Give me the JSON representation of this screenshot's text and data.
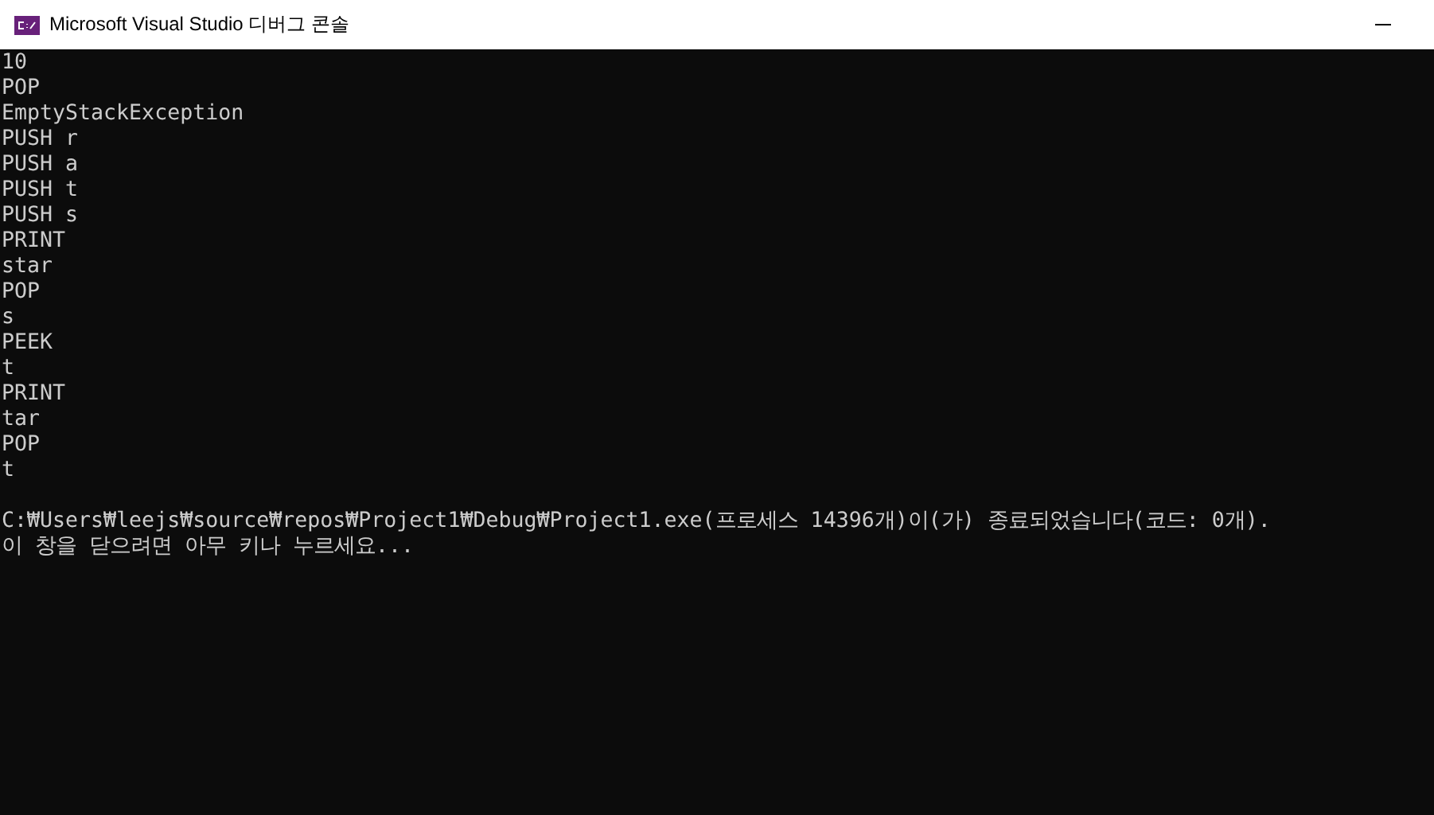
{
  "window": {
    "title": "Microsoft Visual Studio 디버그 콘솔"
  },
  "console": {
    "output_lines": [
      "10",
      "POP",
      "EmptyStackException",
      "PUSH r",
      "PUSH a",
      "PUSH t",
      "PUSH s",
      "PRINT",
      "star",
      "POP",
      "s",
      "PEEK",
      "t",
      "PRINT",
      "tar",
      "POP",
      "t"
    ],
    "exit_message": [
      "C:₩Users₩leejs₩source₩repos₩Project1₩Debug₩Project1.exe(프로세스 14396개)이(가) 종료되었습니다(코드: 0개).",
      "이 창을 닫으려면 아무 키나 누르세요..."
    ]
  }
}
